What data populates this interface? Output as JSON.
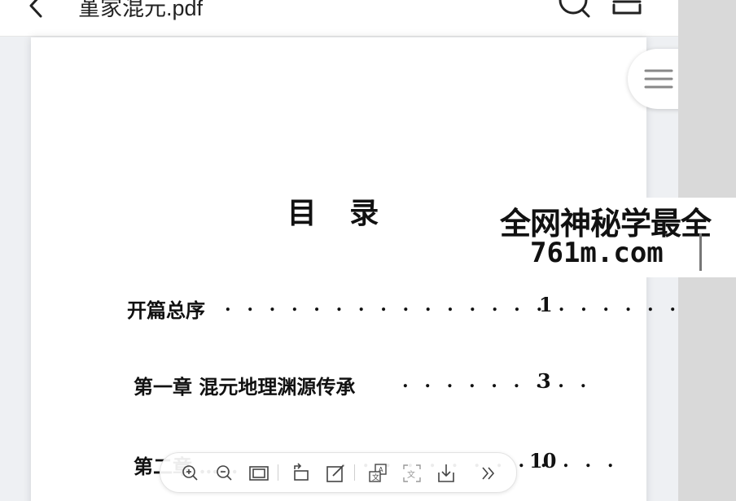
{
  "topbar": {
    "title": "堇家混元.pdf",
    "icons": [
      "chevron-left-icon",
      "search-icon",
      "menu-icon"
    ]
  },
  "document": {
    "heading": "目 录",
    "toc": [
      {
        "label": "开篇总序",
        "dots": ". . . . . . . . . . . . . . . . . . . . . . .",
        "page": "1"
      },
      {
        "label": "第一章 混元地理渊源传承",
        "dots": ". . . . . . . . .",
        "page": "3"
      },
      {
        "label": "第二章 ……",
        "dots": ". . . . . . . . . . . . .",
        "page": "10"
      }
    ]
  },
  "watermark": {
    "line1": "全网神秘学最全",
    "line2": "761m.com"
  },
  "outline_button": {
    "icon": "list-icon"
  },
  "toolbar": {
    "buttons": [
      "zoom-in-icon",
      "zoom-out-icon",
      "fit-page-icon",
      "rotate-icon",
      "annotate-icon",
      "translate-icon",
      "ocr-icon",
      "download-icon",
      "more-icon"
    ]
  },
  "colors": {
    "accent": "#222222",
    "page": "#ffffff",
    "background": "#eef0f3",
    "strip": "#d9d9d9"
  }
}
